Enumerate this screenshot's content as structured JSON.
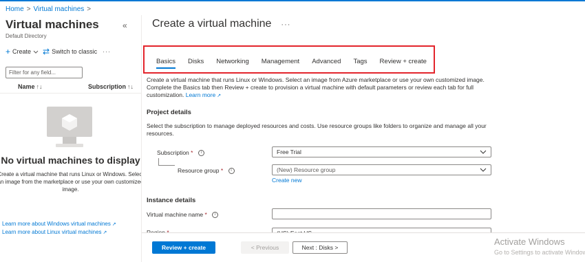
{
  "breadcrumb": {
    "items": [
      "Home",
      "Virtual machines"
    ],
    "separator": ">"
  },
  "left_pane": {
    "title": "Virtual machines",
    "subtitle": "Default Directory",
    "collapse_glyph": "«",
    "toolbar": {
      "create_label": "Create",
      "switch_label": "Switch to classic",
      "more_glyph": "···"
    },
    "filter_placeholder": "Filter for any field...",
    "columns": {
      "name": "Name",
      "subscription": "Subscription",
      "name_sort": "↑↓",
      "subscription_sort": "↑↓"
    },
    "empty_title": "No virtual machines to display",
    "empty_description": "Create a virtual machine that runs Linux or Windows. Select an image from the marketplace or use your own customized image.",
    "links": [
      "Learn more about Windows virtual machines",
      "Learn more about Linux virtual machines"
    ]
  },
  "main": {
    "title": "Create a virtual machine",
    "title_more": "···",
    "tabs": [
      {
        "label": "Basics",
        "active": true
      },
      {
        "label": "Disks",
        "active": false
      },
      {
        "label": "Networking",
        "active": false
      },
      {
        "label": "Management",
        "active": false
      },
      {
        "label": "Advanced",
        "active": false
      },
      {
        "label": "Tags",
        "active": false
      },
      {
        "label": "Review + create",
        "active": false
      }
    ],
    "intro_text": "Create a virtual machine that runs Linux or Windows. Select an image from Azure marketplace or use your own customized image. Complete the Basics tab then Review + create to provision a virtual machine with default parameters or review each tab for full customization.",
    "intro_link": "Learn more",
    "project_details": {
      "heading": "Project details",
      "description": "Select the subscription to manage deployed resources and costs. Use resource groups like folders to organize and manage all your resources.",
      "subscription_label": "Subscription",
      "subscription_value": "Free Trial",
      "resource_group_label": "Resource group",
      "resource_group_value": "(New) Resource group",
      "create_new": "Create new"
    },
    "instance_details": {
      "heading": "Instance details",
      "vm_name_label": "Virtual machine name",
      "vm_name_value": "",
      "region_label_partial": "Region",
      "region_value_partial": "(US) East US"
    },
    "required_mark": "*",
    "info_glyph": "i"
  },
  "footer": {
    "review_create": "Review + create",
    "previous": "< Previous",
    "next": "Next : Disks >"
  },
  "watermark": {
    "line1": "Activate Windows",
    "line2": "Go to Settings to activate Windows."
  },
  "colors": {
    "accent": "#0078d4",
    "highlight_box": "#e3242b",
    "required": "#a4262c"
  },
  "icons": {
    "collapse": "collapse-icon",
    "create": "plus-icon",
    "switch": "switch-arrows-icon",
    "external": "external-link-icon",
    "info": "info-icon",
    "dropdown": "chevron-down-icon",
    "empty_state": "virtual-machine-monitor-icon"
  }
}
